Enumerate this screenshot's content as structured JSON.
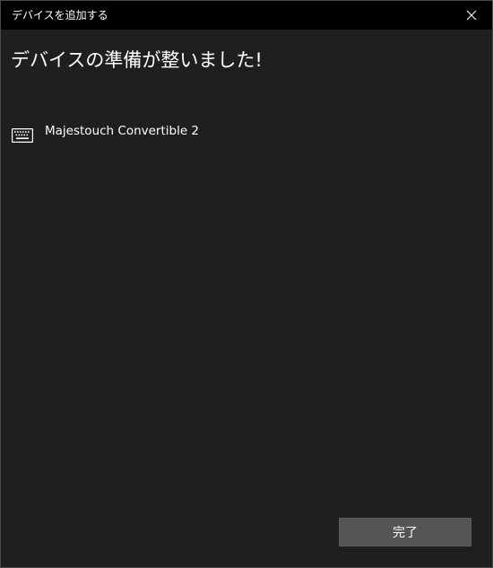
{
  "window": {
    "title": "デバイスを追加する",
    "close_icon": "close-icon"
  },
  "main": {
    "heading": "デバイスの準備が整いました!",
    "device": {
      "icon": "keyboard-icon",
      "name": "Majestouch Convertible 2"
    }
  },
  "footer": {
    "done_label": "完了"
  },
  "colors": {
    "background": "#1f1f1f",
    "titlebar": "#000000",
    "button": "#555555",
    "text": "#ffffff"
  }
}
